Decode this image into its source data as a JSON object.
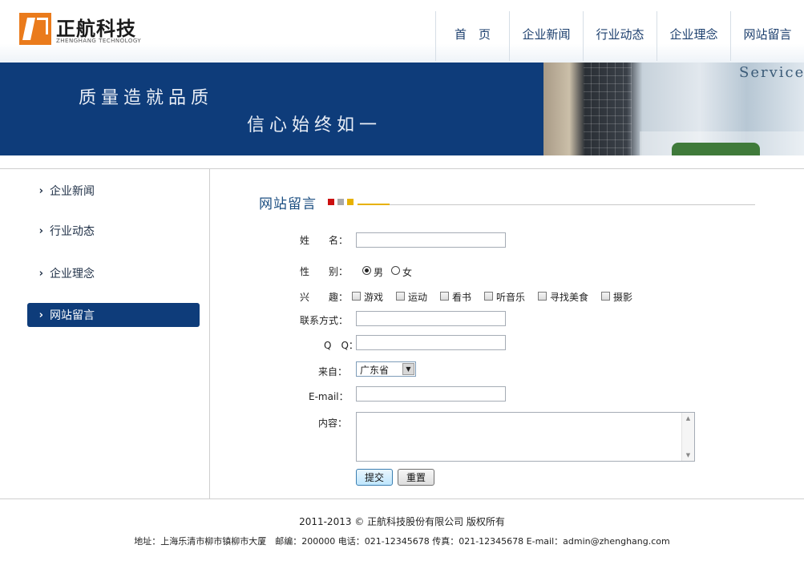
{
  "logo": {
    "cn": "正航科技",
    "en": "ZHENGHANG TECHNOLOGY"
  },
  "nav": {
    "items": [
      "首　页",
      "企业新闻",
      "行业动态",
      "企业理念",
      "网站留言"
    ]
  },
  "banner": {
    "slogan1": "质量造就品质",
    "slogan2": "信心始终如一",
    "service": "Service"
  },
  "sidebar": {
    "items": [
      {
        "label": "企业新闻",
        "active": false
      },
      {
        "label": "行业动态",
        "active": false
      },
      {
        "label": "企业理念",
        "active": false
      },
      {
        "label": "网站留言",
        "active": true
      }
    ]
  },
  "section": {
    "title": "网站留言",
    "square_colors": [
      "#cc1010",
      "#a9a9a9",
      "#e7b100"
    ]
  },
  "form": {
    "name_label": "姓　　名：",
    "name_value": "",
    "gender_label": "性　　别：",
    "gender_options": [
      "男",
      "女"
    ],
    "gender_selected": "男",
    "hobby_label": "兴　　趣：",
    "hobbies": [
      "游戏",
      "运动",
      "看书",
      "听音乐",
      "寻找美食",
      "摄影"
    ],
    "contact_label": "联系方式：",
    "contact_value": "",
    "qq_label": "Q　Q：",
    "qq_value": "",
    "from_label": "来自：",
    "from_selected": "广东省",
    "email_label": "E-mail：",
    "email_value": "",
    "content_label": "内容：",
    "content_value": "",
    "submit_label": "提交",
    "reset_label": "重置"
  },
  "footer": {
    "copyright": "2011-2013 ©  正航科技股份有限公司 版权所有",
    "address": "地址：上海乐清市柳市镇柳市大厦　邮编：200000 电话：021-12345678 传真：021-12345678 E-mail：admin@zhenghang.com"
  },
  "colors": {
    "brand_blue": "#0e3c7a",
    "logo_orange": "#ea7b1c",
    "nav_text": "#1c3f6e"
  }
}
